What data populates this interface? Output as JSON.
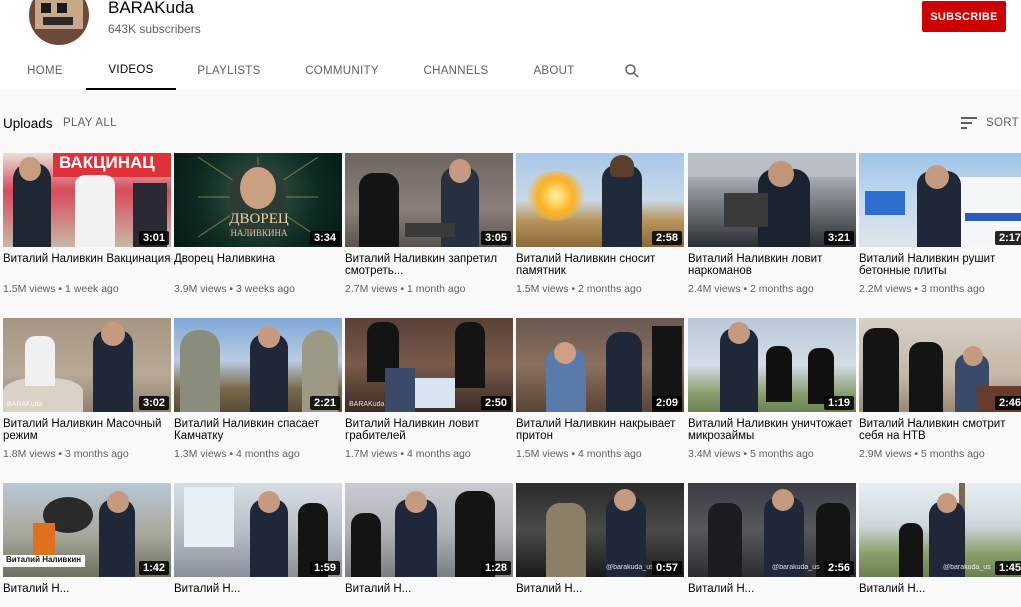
{
  "channel": {
    "name": "BARAKuda",
    "subscribers": "643K subscribers",
    "subscribe_label": "SUBSCRIBE",
    "accent_color": "#cc0000"
  },
  "tabs": [
    {
      "label": "HOME"
    },
    {
      "label": "VIDEOS",
      "active": true
    },
    {
      "label": "PLAYLISTS"
    },
    {
      "label": "COMMUNITY"
    },
    {
      "label": "CHANNELS"
    },
    {
      "label": "ABOUT"
    }
  ],
  "search_icon": "search-icon",
  "uploads": {
    "label": "Uploads",
    "play_all": "PLAY ALL",
    "sort_label": "SORT BY"
  },
  "videos": [
    {
      "title": "Виталий Наливкин Вакцинация",
      "views": "1.5M views",
      "age": "1 week ago",
      "duration": "3:01"
    },
    {
      "title": "Дворец Наливкина",
      "views": "3.9M views",
      "age": "3 weeks ago",
      "duration": "3:34"
    },
    {
      "title": "Виталий Наливкин запретил смотреть...",
      "views": "2.7M views",
      "age": "1 month ago",
      "duration": "3:05"
    },
    {
      "title": "Виталий Наливкин сносит памятник",
      "views": "1.5M views",
      "age": "2 months ago",
      "duration": "2:58"
    },
    {
      "title": "Виталий Наливкин ловит наркоманов",
      "views": "2.4M views",
      "age": "2 months ago",
      "duration": "3:21"
    },
    {
      "title": "Виталий Наливкин рушит бетонные плиты",
      "views": "2.2M views",
      "age": "3 months ago",
      "duration": "2:17"
    },
    {
      "title": "Виталий Наливкин Масочный режим",
      "views": "1.8M views",
      "age": "3 months ago",
      "duration": "3:02"
    },
    {
      "title": "Виталий Наливкин спасает Камчатку",
      "views": "1.3M views",
      "age": "4 months ago",
      "duration": "2:21"
    },
    {
      "title": "Виталий Наливкин ловит грабителей",
      "views": "1.7M views",
      "age": "4 months ago",
      "duration": "2:50"
    },
    {
      "title": "Виталий Наливкин накрывает притон",
      "views": "1.5M views",
      "age": "4 months ago",
      "duration": "2:09"
    },
    {
      "title": "Виталий Наливкин уничтожает микрозаймы",
      "views": "3.4M views",
      "age": "5 months ago",
      "duration": "1:19"
    },
    {
      "title": "Виталий Наливкин смотрит себя на НТВ",
      "views": "2.9M views",
      "age": "5 months ago",
      "duration": "2:46"
    },
    {
      "title": "Виталий Н...",
      "views": "",
      "age": "",
      "duration": "1:42"
    },
    {
      "title": "Виталий Н...",
      "views": "",
      "age": "",
      "duration": "1:59"
    },
    {
      "title": "Виталий Н...",
      "views": "",
      "age": "",
      "duration": "1:28"
    },
    {
      "title": "Виталий Н...",
      "views": "",
      "age": "",
      "duration": "0:57"
    },
    {
      "title": "Виталий Н...",
      "views": "",
      "age": "",
      "duration": "2:56"
    },
    {
      "title": "Виталий Н...",
      "views": "",
      "age": "",
      "duration": "1:45"
    }
  ],
  "thumb_texts": {
    "v1_banner": "ВАКЦИНАЦ",
    "v2_title": "ДВОРЕЦ",
    "v2_sub": "НАЛИВКИНА",
    "v13_label": "Виталий Наливкин",
    "watermark": "@barakuda_us",
    "brand": "BARAKuda"
  },
  "meta_separator": " • "
}
